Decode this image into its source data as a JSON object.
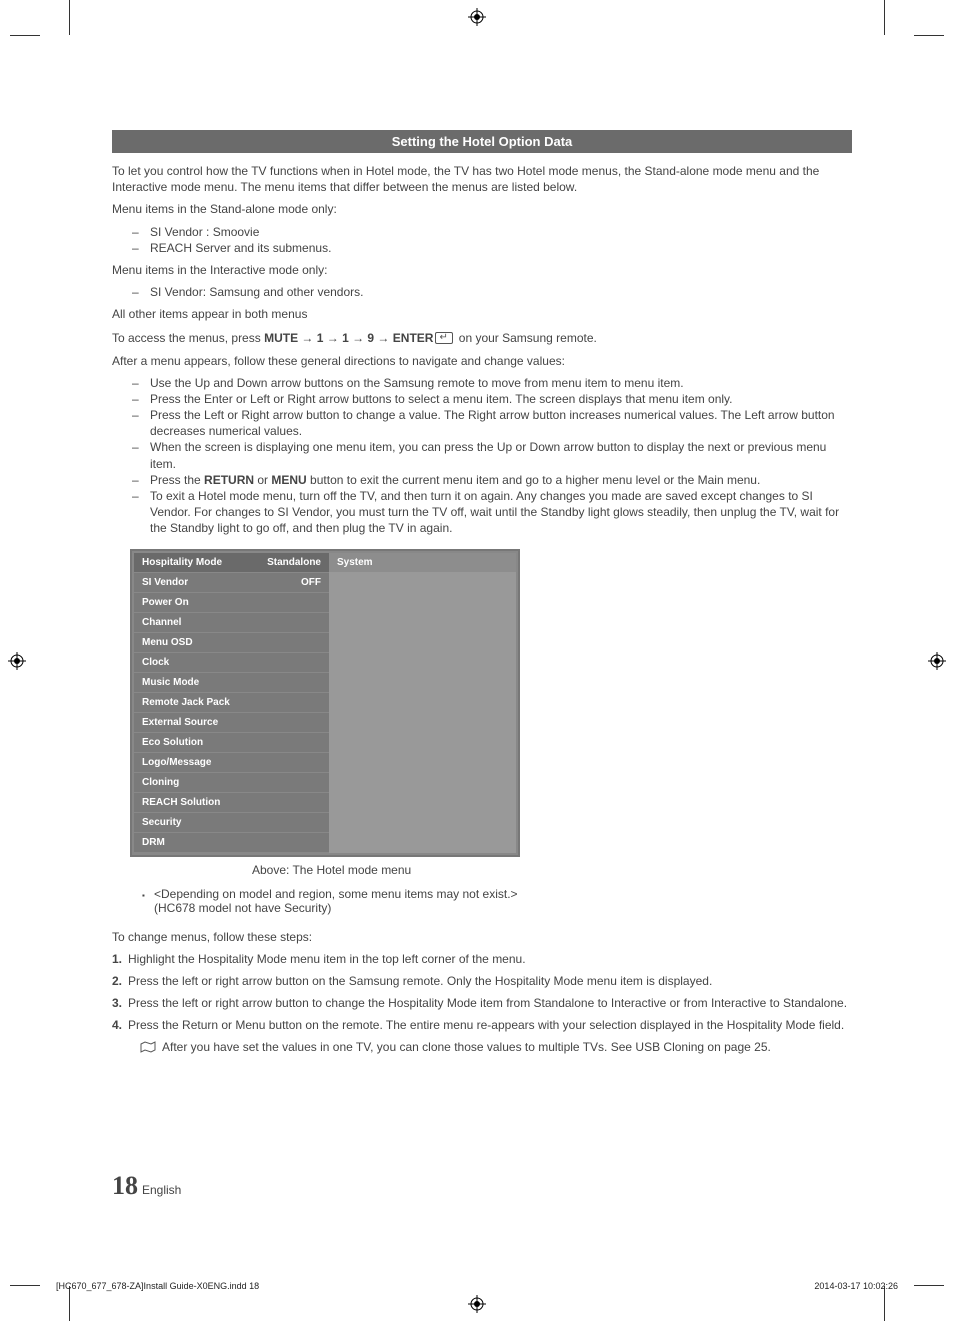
{
  "heading": "Setting the Hotel Option Data",
  "intro": "To let you control how the TV functions when in Hotel mode, the TV has two Hotel mode menus, the Stand-alone mode menu and the Interactive mode menu. The menu items that differ between the menus are listed below.",
  "standalone_intro": "Menu items in the Stand-alone mode only:",
  "standalone_items": [
    "SI Vendor : Smoovie",
    "REACH Server and its submenus."
  ],
  "interactive_intro": "Menu items in the Interactive mode only:",
  "interactive_items": [
    "SI Vendor: Samsung and other vendors."
  ],
  "both_line": "All other items appear in both menus",
  "access_prefix": "To access the menus, press ",
  "access_seq": "MUTE → 1 → 1 → 9 → ENTER",
  "access_suffix": " on your Samsung remote.",
  "after_line": "After a menu appears, follow these general directions to navigate and change values:",
  "directions": [
    "Use the Up and Down arrow buttons on the Samsung remote to move from menu item to menu item.",
    "Press the Enter or Left or Right arrow buttons to select a menu item. The screen displays that menu item only.",
    "Press the Left or Right arrow button to change a value. The Right arrow button increases numerical values. The Left arrow button decreases numerical values.",
    "When the screen is displaying one menu item, you can press the Up or Down arrow button to display the next or previous menu item.",
    "Press the RETURN or MENU button to exit the current menu item and go to a higher menu level or the Main menu.",
    "To exit a Hotel mode menu, turn off the TV, and then turn it on again. Any changes you made are saved except changes to SI Vendor. For changes to SI Vendor, you must turn the TV off, wait until the Standby light glows steadily, then unplug the TV, wait for the Standby light to go off, and then plug the TV in again."
  ],
  "return_word": "RETURN",
  "menu_word": "MENU",
  "menu": {
    "header_label": "Hospitality Mode",
    "header_value": "Standalone",
    "right_header": "System",
    "si_label": "SI Vendor",
    "si_value": "OFF",
    "items": [
      "Power On",
      "Channel",
      "Menu OSD",
      "Clock",
      "Music Mode",
      "Remote Jack Pack",
      "External Source",
      "Eco Solution",
      "Logo/Message",
      "Cloning",
      "REACH Solution",
      "Security",
      "DRM"
    ]
  },
  "caption": "Above: The Hotel mode menu",
  "depend_note_l1": "<Depending on model and region, some menu items may not exist.>",
  "depend_note_l2": "(HC678 model not have Security)",
  "change_intro": "To change menus, follow these steps:",
  "steps": [
    {
      "n": "1.",
      "t": "Highlight the Hospitality Mode menu item in the top left corner of the menu."
    },
    {
      "n": "2.",
      "t": "Press the left or right arrow button on the Samsung remote. Only the Hospitality Mode menu item is displayed."
    },
    {
      "n": "3.",
      "t": "Press the left or right arrow button to change the Hospitality Mode item from Standalone to Interactive or from Interactive to Standalone."
    },
    {
      "n": "4.",
      "t": "Press the Return or Menu button on the remote. The entire menu re-appears with your selection displayed in the Hospitality Mode field."
    }
  ],
  "clone_note": "After you have set the values in one TV, you can clone those values to multiple TVs. See USB Cloning on page 25.",
  "page_number": "18",
  "page_lang": "English",
  "footer_left": "[HC670_677_678-ZA]Install Guide-X0ENG.indd   18",
  "footer_right": "2014-03-17    10:02:26"
}
